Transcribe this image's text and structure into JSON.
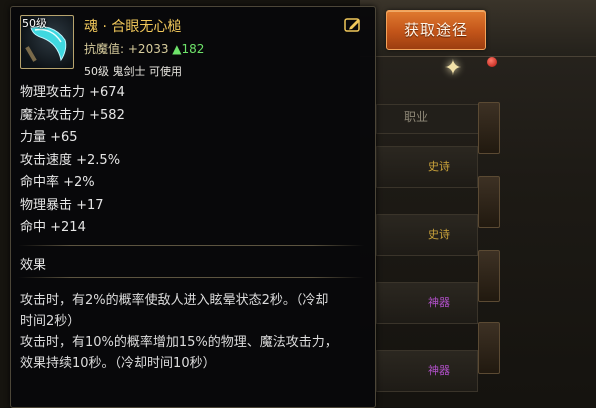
{
  "get_source_button": {
    "label": "获取途径"
  },
  "background": {
    "header_label": "职业",
    "rows": [
      {
        "tag": "史诗",
        "tag_color": "#c9a23a"
      },
      {
        "tag": "史诗",
        "tag_color": "#c9a23a"
      },
      {
        "tag": "神器",
        "tag_color": "#b050c8"
      },
      {
        "tag": "神器",
        "tag_color": "#b050c8"
      }
    ]
  },
  "tooltip": {
    "level_badge": "50级",
    "item_name": "魂 · 合眼无心槌",
    "resist_label": "抗魔值:",
    "resist_value": "+2033",
    "resist_delta": "▲182",
    "requirement": "50级 鬼剑士 可使用",
    "stats": [
      "物理攻击力 +674",
      "魔法攻击力 +582",
      "力量 +65",
      "攻击速度 +2.5%",
      "命中率 +2%",
      "物理暴击 +17",
      "命中 +214"
    ],
    "effect_title": "效果",
    "effect_lines": [
      "攻击时，有2%的概率使敌人进入眩晕状态2秒。（冷却",
      "时间2秒）",
      "攻击时，有10%的概率增加15%的物理、魔法攻击力，",
      "效果持续10秒。（冷却时间10秒）"
    ]
  },
  "colors": {
    "item_name": "#f0c75a",
    "resist_up": "#6ee36a",
    "button_orange": "#c25419"
  }
}
